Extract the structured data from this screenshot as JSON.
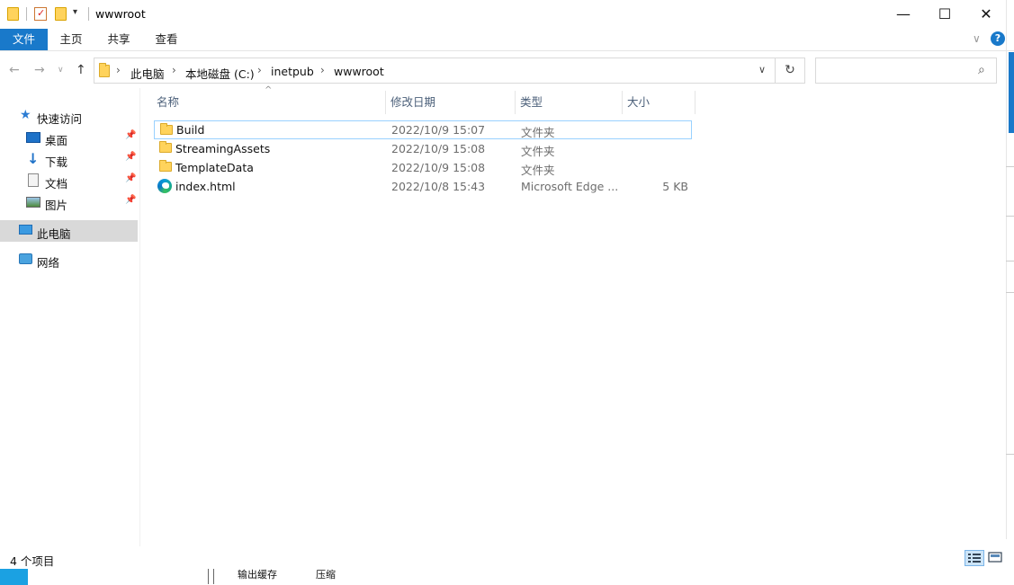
{
  "window": {
    "title": "wwwroot",
    "minimize_glyph": "—",
    "maximize_glyph": "☐",
    "close_glyph": "✕"
  },
  "ribbon": {
    "tabs": [
      {
        "label": "文件"
      },
      {
        "label": "主页"
      },
      {
        "label": "共享"
      },
      {
        "label": "查看"
      }
    ],
    "help_glyph": "?",
    "collapse_glyph": "∨"
  },
  "address": {
    "breadcrumbs": [
      "此电脑",
      "本地磁盘 (C:)",
      "inetpub",
      "wwwroot"
    ],
    "separator": "›",
    "dropdown_glyph": "∨",
    "refresh_glyph": "↻",
    "search_placeholder": "",
    "search_glyph": "⌕"
  },
  "nav_arrows": {
    "back": "←",
    "forward": "→",
    "recent": "∨",
    "up": "↑"
  },
  "navpane": {
    "quick_access": "快速访问",
    "items": [
      {
        "label": "桌面",
        "icon": "desktop-icon",
        "pinned": true
      },
      {
        "label": "下载",
        "icon": "download-icon",
        "pinned": true
      },
      {
        "label": "文档",
        "icon": "document-icon",
        "pinned": true
      },
      {
        "label": "图片",
        "icon": "pictures-icon",
        "pinned": true
      }
    ],
    "this_pc": "此电脑",
    "network": "网络",
    "pin_glyph": "📌"
  },
  "columns": {
    "name": "名称",
    "date": "修改日期",
    "type": "类型",
    "size": "大小",
    "sort_glyph": "^"
  },
  "files": [
    {
      "name": "Build",
      "date": "2022/10/9 15:07",
      "type": "文件夹",
      "size": "",
      "icon": "folder-icon"
    },
    {
      "name": "StreamingAssets",
      "date": "2022/10/9 15:08",
      "type": "文件夹",
      "size": "",
      "icon": "folder-icon"
    },
    {
      "name": "TemplateData",
      "date": "2022/10/9 15:08",
      "type": "文件夹",
      "size": "",
      "icon": "folder-icon"
    },
    {
      "name": "index.html",
      "date": "2022/10/8 15:43",
      "type": "Microsoft Edge ...",
      "size": "5 KB",
      "icon": "edge-html-icon"
    }
  ],
  "status": {
    "item_count": "4 个项目"
  },
  "taskstrip": {
    "item1": "输出缓存",
    "item2": "压缩"
  },
  "colors": {
    "accent": "#1979ca",
    "selection_border": "#99d1ff",
    "folder": "#ffd35c"
  }
}
